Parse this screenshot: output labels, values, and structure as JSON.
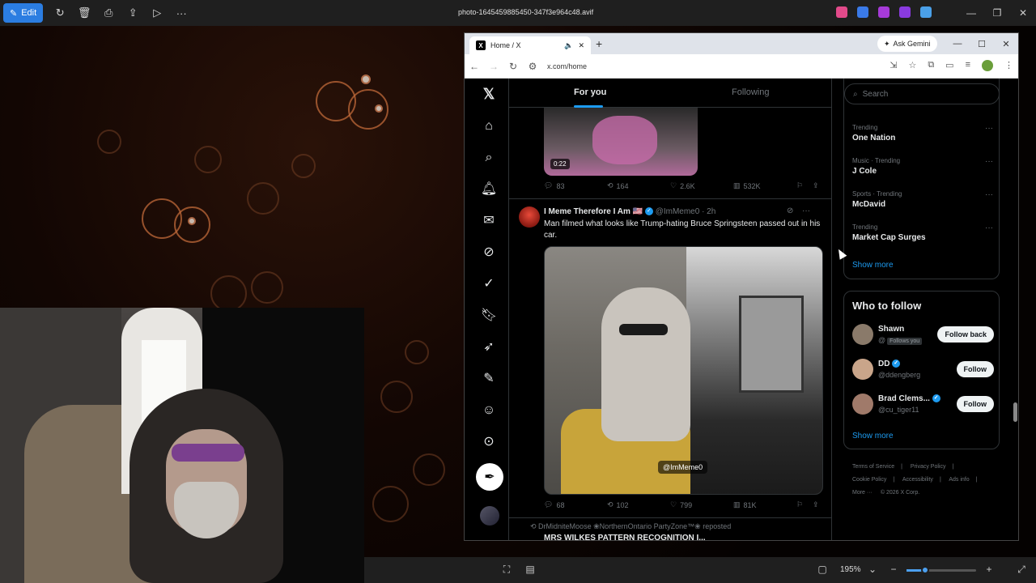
{
  "viewer": {
    "edit_label": "Edit",
    "filename": "photo-1645459885450-347f3e964c48.avif",
    "zoom": "195%"
  },
  "browser": {
    "tab_title": "Home / X",
    "url": "x.com/home",
    "ask_gemini": "Ask Gemini"
  },
  "x": {
    "tabs": {
      "for_you": "For you",
      "following": "Following"
    },
    "prev_post": {
      "video_time": "0:22",
      "replies": "83",
      "reposts": "164",
      "likes": "2.6K",
      "views": "532K"
    },
    "post": {
      "name": "I Meme Therefore I Am",
      "flag": "🇺🇸",
      "handle": "@ImMeme0",
      "time": "· 2h",
      "text": "Man filmed what looks like Trump-hating Bruce Springsteen passed out in his car.",
      "media_tag": "@ImMeme0",
      "replies": "68",
      "reposts": "102",
      "likes": "799",
      "views": "81K"
    },
    "next_post": {
      "repost_line": "DrMidniteMoose ❀NorthernOntario PartyZone™❀ reposted",
      "name": "MRS WILKES PATTERN RECOGNITION I..."
    },
    "search_placeholder": "Search",
    "trends": [
      {
        "meta": "Trending",
        "name": "One Nation"
      },
      {
        "meta": "Music · Trending",
        "name": "J Cole"
      },
      {
        "meta": "Sports · Trending",
        "name": "McDavid"
      },
      {
        "meta": "Trending",
        "name": "Market Cap Surges"
      }
    ],
    "show_more": "Show more",
    "who_to_follow": {
      "title": "Who to follow",
      "users": [
        {
          "name": "Shawn",
          "handle": "@",
          "badge": "Follows you",
          "button": "Follow back"
        },
        {
          "name": "DD",
          "handle": "@ddengberg",
          "button": "Follow"
        },
        {
          "name": "Brad Clems...",
          "handle": "@cu_tiger11",
          "button": "Follow"
        }
      ],
      "show_more": "Show more"
    },
    "footer": {
      "terms": "Terms of Service",
      "privacy": "Privacy Policy",
      "cookie": "Cookie Policy",
      "accessibility": "Accessibility",
      "ads": "Ads info",
      "more": "More ···",
      "copyright": "© 2026 X Corp."
    }
  }
}
